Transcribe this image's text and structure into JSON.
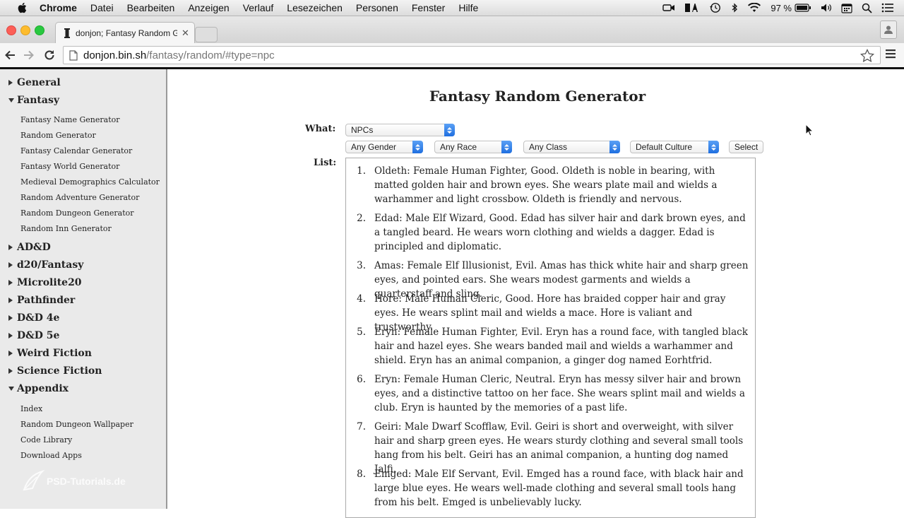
{
  "menubar": {
    "app": "Chrome",
    "items": [
      "Datei",
      "Bearbeiten",
      "Anzeigen",
      "Verlauf",
      "Lesezeichen",
      "Personen",
      "Fenster",
      "Hilfe"
    ],
    "battery": "97 %"
  },
  "browser": {
    "tab_title": "donjon; Fantasy Random G",
    "url_host": "donjon.bin.sh",
    "url_path": "/fantasy/random/#type=npc"
  },
  "sidebar": {
    "sections": [
      {
        "label": "General",
        "expanded": false,
        "items": []
      },
      {
        "label": "Fantasy",
        "expanded": true,
        "items": [
          "Fantasy Name Generator",
          "Random Generator",
          "Fantasy Calendar Generator",
          "Fantasy World Generator",
          "Medieval Demographics Calculator",
          "Random Adventure Generator",
          "Random Dungeon Generator",
          "Random Inn Generator"
        ]
      },
      {
        "label": "AD&D",
        "expanded": false,
        "items": []
      },
      {
        "label": "d20/Fantasy",
        "expanded": false,
        "items": []
      },
      {
        "label": "Microlite20",
        "expanded": false,
        "items": []
      },
      {
        "label": "Pathfinder",
        "expanded": false,
        "items": []
      },
      {
        "label": "D&D 4e",
        "expanded": false,
        "items": []
      },
      {
        "label": "D&D 5e",
        "expanded": false,
        "items": []
      },
      {
        "label": "Weird Fiction",
        "expanded": false,
        "items": []
      },
      {
        "label": "Science Fiction",
        "expanded": false,
        "items": []
      },
      {
        "label": "Appendix",
        "expanded": true,
        "items": [
          "Index",
          "Random Dungeon Wallpaper",
          "Code Library",
          "Download Apps"
        ]
      }
    ],
    "watermark": "PSD-Tutorials.de"
  },
  "main": {
    "title": "Fantasy Random Generator",
    "what_label": "What:",
    "list_label": "List:",
    "what_select": "NPCs",
    "filters": {
      "gender": "Any Gender",
      "race": "Any Race",
      "class": "Any Class",
      "culture": "Default Culture"
    },
    "select_button": "Select",
    "npcs": [
      {
        "num": "1.",
        "text": "Oldeth: Female Human Fighter, Good. Oldeth is noble in bearing, with matted golden hair and brown eyes. She wears plate mail and wields a warhammer and light crossbow. Oldeth is friendly and nervous."
      },
      {
        "num": "2.",
        "text": "Edad: Male Elf Wizard, Good. Edad has silver hair and dark brown eyes, and a tangled beard. He wears worn clothing and wields a dagger. Edad is principled and diplomatic."
      },
      {
        "num": "3.",
        "text": "Amas: Female Elf Illusionist, Evil. Amas has thick white hair and sharp green eyes, and pointed ears. She wears modest garments and wields a quarterstaff and sling."
      },
      {
        "num": "4.",
        "text": "Hore: Male Human Cleric, Good. Hore has braided copper hair and gray eyes. He wears splint mail and wields a mace. Hore is valiant and trustworthy."
      },
      {
        "num": "5.",
        "text": "Eryn: Female Human Fighter, Evil. Eryn has a round face, with tangled black hair and hazel eyes. She wears banded mail and wields a warhammer and shield. Eryn has an animal companion, a ginger dog named Eorhtfrid."
      },
      {
        "num": "6.",
        "text": "Eryn: Female Human Cleric, Neutral. Eryn has messy silver hair and brown eyes, and a distinctive tattoo on her face. She wears splint mail and wields a club. Eryn is haunted by the memories of a past life."
      },
      {
        "num": "7.",
        "text": "Geiri: Male Dwarf Scofflaw, Evil. Geiri is short and overweight, with silver hair and sharp green eyes. He wears sturdy clothing and several small tools hang from his belt. Geiri has an animal companion, a hunting dog named Jalfi."
      },
      {
        "num": "8.",
        "text": "Emged: Male Elf Servant, Evil. Emged has a round face, with black hair and large blue eyes. He wears well-made clothing and several small tools hang from his belt. Emged is unbelievably lucky."
      }
    ]
  }
}
